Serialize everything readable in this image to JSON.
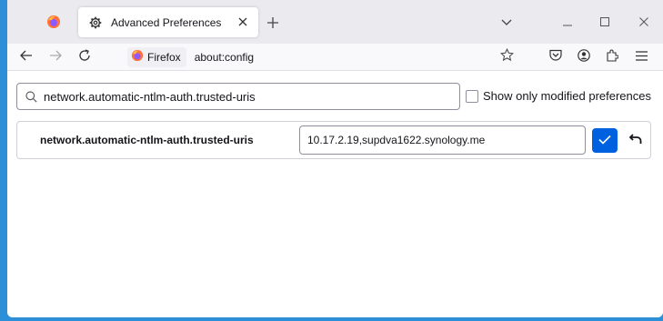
{
  "tab": {
    "title": "Advanced Preferences"
  },
  "urlbar": {
    "identity_label": "Firefox",
    "url": "about:config"
  },
  "search": {
    "value": "network.automatic-ntlm-auth.trusted-uris"
  },
  "filter": {
    "label": "Show only modified preferences",
    "checked": false
  },
  "preference": {
    "name": "network.automatic-ntlm-auth.trusted-uris",
    "value": "10.17.2.19,supdva1622.synology.me"
  },
  "colors": {
    "accent": "#0061e0",
    "desktop": "#2d8fd8",
    "firefox_orange": "#ff7139",
    "firefox_purple": "#9059ff"
  },
  "icons": [
    "firefox-view-icon",
    "gear-icon",
    "close-icon",
    "plus-icon",
    "chevron-down-icon",
    "minimize-icon",
    "maximize-icon",
    "back-icon",
    "forward-icon",
    "reload-icon",
    "firefox-logo-icon",
    "star-icon",
    "pocket-icon",
    "account-icon",
    "extensions-icon",
    "menu-icon",
    "search-icon",
    "checkmark-icon",
    "undo-icon"
  ]
}
